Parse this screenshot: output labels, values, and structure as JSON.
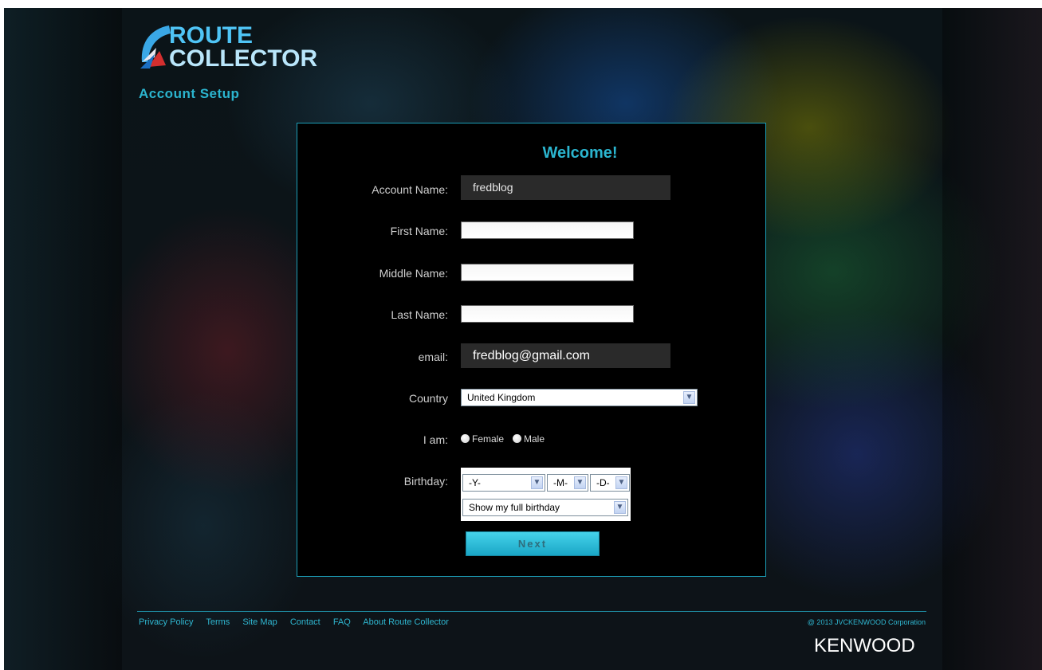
{
  "brand": {
    "logo_line1": "ROUTE",
    "logo_line2": "COLLECTOR",
    "page_heading": "Account Setup"
  },
  "form": {
    "welcome": "Welcome!",
    "account_name_label": "Account Name:",
    "account_name_value": "fredblog",
    "first_name_label": "First Name:",
    "first_name_value": "",
    "middle_name_label": "Middle Name:",
    "middle_name_value": "",
    "last_name_label": "Last Name:",
    "last_name_value": "",
    "email_label": "email:",
    "email_value": "fredblog@gmail.com",
    "country_label": "Country",
    "country_value": "United Kingdom",
    "gender_label": "I am:",
    "gender_options": [
      "Female",
      "Male"
    ],
    "birthday_label": "Birthday:",
    "birthday_year": "-Y-",
    "birthday_month": "-M-",
    "birthday_day": "-D-",
    "birthday_visibility": "Show my full birthday",
    "next_label": "Next"
  },
  "footer": {
    "links": [
      "Privacy Policy",
      "Terms",
      "Site Map",
      "Contact",
      "FAQ",
      "About Route Collector"
    ],
    "copyright": "@ 2013 JVCKENWOOD Corporation",
    "kenwood_logo": "KENWOOD"
  },
  "colors": {
    "accent": "#2bb5cf",
    "panel_border": "#1c9fb8",
    "button": "#1aa6c6"
  }
}
